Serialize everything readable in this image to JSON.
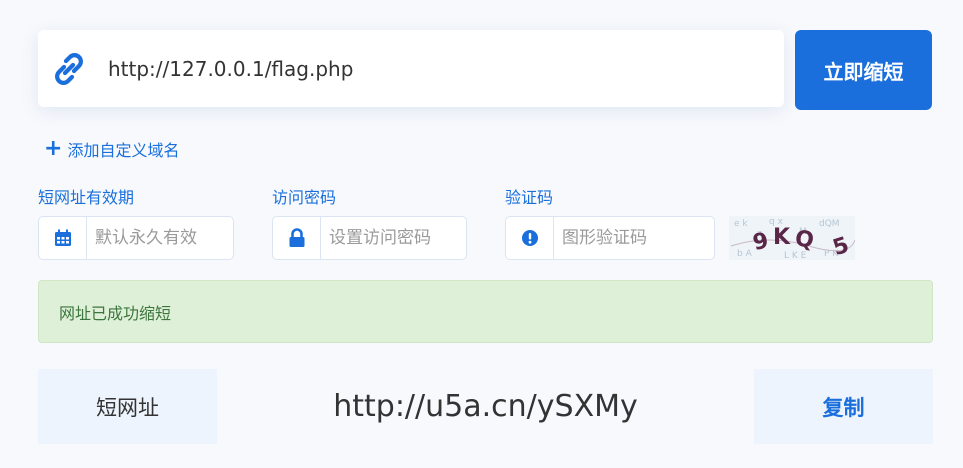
{
  "url_input": {
    "value": "http://127.0.0.1/flag.php",
    "icon": "link-icon"
  },
  "shorten_button": {
    "label": "立即缩短",
    "color": "#1a6fdc"
  },
  "add_domain": {
    "label": "添加自定义域名"
  },
  "fields": {
    "expiry": {
      "label": "短网址有效期",
      "placeholder": "默认永久有效",
      "icon": "calendar-icon"
    },
    "password": {
      "label": "访问密码",
      "placeholder": "设置访问密码",
      "icon": "lock-icon"
    },
    "captcha": {
      "label": "验证码",
      "placeholder": "图形验证码",
      "icon": "exclamation-circle-icon",
      "image_text": "9KQ5"
    }
  },
  "success_message": "网址已成功缩短",
  "result": {
    "label": "短网址",
    "value": "http://u5a.cn/ySXMy",
    "copy_label": "复制"
  }
}
